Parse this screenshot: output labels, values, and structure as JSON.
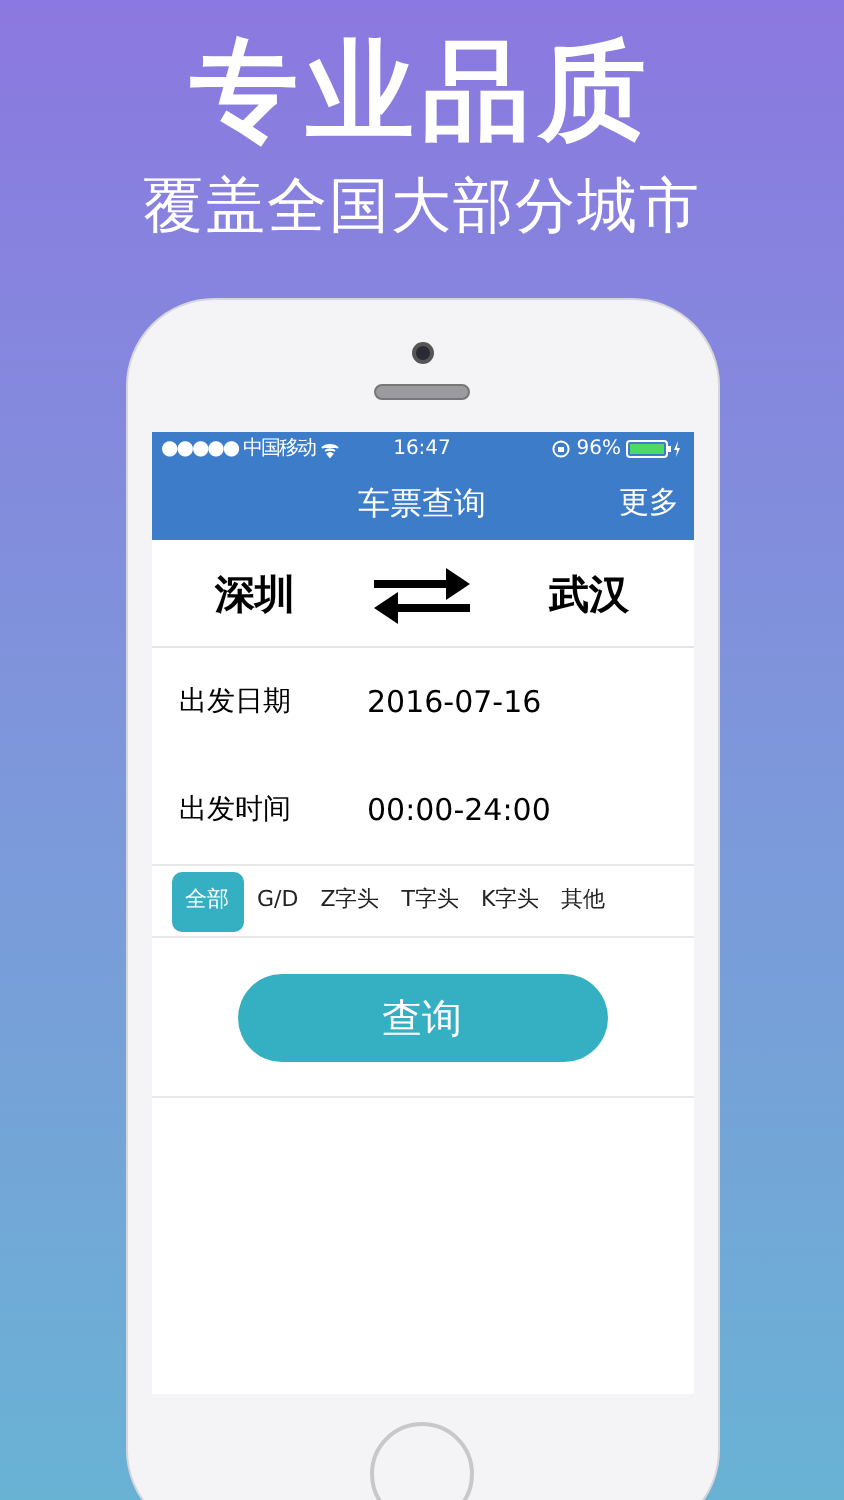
{
  "headline": "专业品质",
  "subheadline": "覆盖全国大部分城市",
  "status_bar": {
    "carrier": "●●●●● 中国移动",
    "time": "16:47",
    "battery": "96%"
  },
  "nav": {
    "title": "车票查询",
    "action": "更多"
  },
  "route": {
    "from": "深圳",
    "to": "武汉"
  },
  "fields": [
    {
      "label": "出发日期",
      "value": "2016-07-16"
    },
    {
      "label": "出发时间",
      "value": "00:00-24:00"
    }
  ],
  "filters": [
    {
      "label": "全部",
      "selected": true
    },
    {
      "label": "G/D",
      "selected": false
    },
    {
      "label": "Z字头",
      "selected": false
    },
    {
      "label": "T字头",
      "selected": false
    },
    {
      "label": "K字头",
      "selected": false
    },
    {
      "label": "其他",
      "selected": false
    }
  ],
  "search_button": "查询"
}
